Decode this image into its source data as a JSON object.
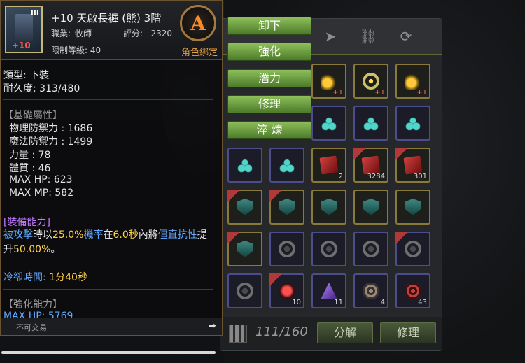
{
  "tooltip": {
    "item_name": "+10 天啟長褲 (熊) 3階",
    "tier_badge": "III",
    "plus_badge": "+10",
    "job_label": "職業:",
    "job_value": "牧師",
    "score_label": "評分:",
    "score_value": "2320",
    "level_label": "限制等級:",
    "level_value": "40",
    "grade": "A",
    "bound": "角色綁定",
    "type_line": "類型:  下裝",
    "durability_line": "耐久度:  313/480",
    "basic_header": "【基礎屬性】",
    "stats": [
      "物理防禦力 : 1686",
      "魔法防禦力 : 1499",
      "力量 : 78",
      "體質 : 46",
      "MAX HP:   623",
      "MAX MP:   582"
    ],
    "equip_header": "[裝備能力]",
    "effect_parts": [
      "被攻擊",
      "時以",
      "25.0%",
      "機率",
      "在",
      "6.0秒",
      "內將",
      "僵直抗性",
      "提升",
      "50.00%",
      "。"
    ],
    "cooldown_label": "冷卻時間:",
    "cooldown_value": "1分40秒",
    "enhance_header": "【強化能力】",
    "enhance_line": "MAX HP:   5769",
    "tradeable": "不可交易",
    "share_icon": "share-arrow-icon"
  },
  "menu": {
    "items": [
      "卸下",
      "強化",
      "潛力",
      "修理",
      "淬 煉"
    ]
  },
  "inventory": {
    "filters": [
      "paper-plane-icon",
      "link-icon",
      "refresh-circle-icon"
    ],
    "slots": [
      {
        "icon": "earring",
        "frame": "y",
        "label": "+1"
      },
      {
        "icon": "ring",
        "frame": "y",
        "label": "+1"
      },
      {
        "icon": "earring",
        "frame": "y",
        "label": "+1"
      },
      {
        "icon": "teal-earring",
        "frame": "b",
        "label": ""
      },
      {
        "icon": "teal-earring",
        "frame": "b",
        "label": ""
      },
      {
        "icon": "teal-earring",
        "frame": "b",
        "label": ""
      },
      {
        "icon": "teal-necklace",
        "frame": "b",
        "label": ""
      },
      {
        "icon": "teal-ring",
        "frame": "b",
        "label": ""
      },
      {
        "icon": "red-crystal",
        "frame": "y",
        "label": "2"
      },
      {
        "icon": "red-crystal",
        "frame": "y",
        "label": "3284"
      },
      {
        "icon": "red-crystal",
        "frame": "y",
        "label": "301"
      },
      {
        "icon": "shield",
        "frame": "y",
        "label": ""
      },
      {
        "icon": "shield",
        "frame": "y",
        "label": ""
      },
      {
        "icon": "shield",
        "frame": "y",
        "label": ""
      },
      {
        "icon": "shield",
        "frame": "y",
        "label": ""
      },
      {
        "icon": "shield",
        "frame": "y",
        "label": ""
      },
      {
        "icon": "shield",
        "frame": "y",
        "label": ""
      },
      {
        "icon": "gear",
        "frame": "b",
        "label": ""
      },
      {
        "icon": "gear",
        "frame": "b",
        "label": ""
      },
      {
        "icon": "gear",
        "frame": "b",
        "label": ""
      },
      {
        "icon": "gear",
        "frame": "b",
        "label": ""
      },
      {
        "icon": "gear",
        "frame": "b",
        "label": ""
      },
      {
        "icon": "potion",
        "frame": "b",
        "label": "10"
      },
      {
        "icon": "sword",
        "frame": "b",
        "label": "11"
      },
      {
        "icon": "orb",
        "frame": "b",
        "label": "4"
      },
      {
        "icon": "red-orb",
        "frame": "b",
        "label": "43"
      }
    ],
    "count": "111/160",
    "disassemble": "分解",
    "repair": "修理"
  }
}
